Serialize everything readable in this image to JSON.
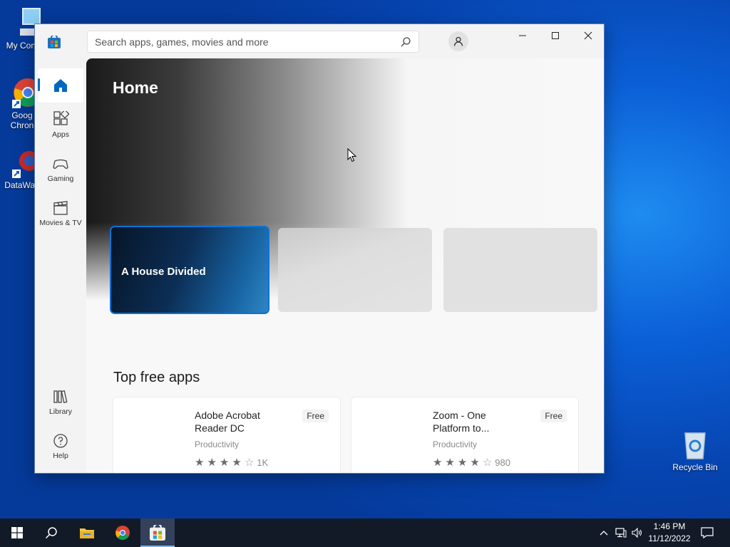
{
  "desktop": {
    "icons": [
      {
        "label": "My Com"
      },
      {
        "label": "Goog"
      },
      {
        "label": "Chron"
      },
      {
        "label": "DataWag"
      },
      {
        "label": "Recycle Bin"
      }
    ]
  },
  "store": {
    "search_placeholder": "Search apps, games, movies and more",
    "nav": {
      "home": "Home",
      "apps": "Apps",
      "gaming": "Gaming",
      "movies": "Movies & TV",
      "library": "Library",
      "help": "Help"
    },
    "hero": {
      "title": "Home",
      "cards": [
        {
          "title": "A House Divided"
        },
        {
          "title": ""
        },
        {
          "title": ""
        }
      ]
    },
    "section_title": "Top free apps",
    "apps": [
      {
        "name": "Adobe Acrobat Reader DC",
        "price": "Free",
        "category": "Productivity",
        "rating": 4,
        "rating_count": "1K"
      },
      {
        "name": "Zoom - One Platform to...",
        "price": "Free",
        "category": "Productivity",
        "rating": 4,
        "rating_count": "980"
      }
    ]
  },
  "taskbar": {
    "time": "1:46 PM",
    "date": "11/12/2022"
  },
  "icons": [
    "windows-start-icon",
    "search-icon",
    "file-explorer-icon",
    "chrome-icon",
    "store-icon",
    "chevron-up-icon",
    "network-icon",
    "volume-icon",
    "notification-icon",
    "user-icon",
    "minimize-icon",
    "maximize-icon",
    "close-icon",
    "home-icon",
    "apps-icon",
    "gaming-icon",
    "movies-icon",
    "library-icon",
    "help-icon",
    "star-icon"
  ],
  "colors": {
    "accent": "#0067c0",
    "taskbar": "#121a28",
    "desktop": "#0b5fd6"
  }
}
